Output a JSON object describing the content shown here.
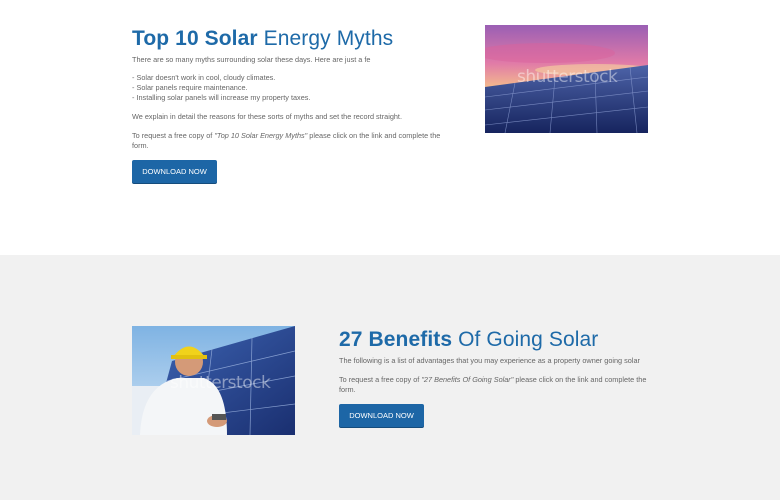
{
  "myths": {
    "title_bold": "Top 10 Solar",
    "title_rest": "Energy Myths",
    "intro": "There are so many myths surrounding solar these days. Here are just a fe",
    "list": [
      "- Solar doesn't work in cool, cloudy climates.",
      "- Solar panels require maintenance.",
      "- Installing solar panels will increase my property taxes."
    ],
    "explain": "We explain in detail the reasons for these sorts of myths and set the record straight.",
    "request_pre": "To request a free copy of ",
    "request_title": "\"Top 10 Solar Energy Myths\"",
    "request_post": " please click on the link and complete the",
    "request_line2": "form.",
    "button": "DOWNLOAD NOW",
    "image_watermark": "shutterstock"
  },
  "benefits": {
    "title_bold": "27 Benefits",
    "title_rest": "Of Going Solar",
    "intro": "The following is a list of advantages that you may experience as a property owner going solar",
    "request_pre": "To request a free copy of ",
    "request_title": "\"27 Benefits Of Going Solar\"",
    "request_post": " please click on the link and complete the",
    "request_line2": "form.",
    "button": "DOWNLOAD NOW",
    "image_watermark": "shutterstock"
  },
  "colors": {
    "accent": "#1e6aa8",
    "button": "#1d66a6",
    "section_bg": "#f1f1f1"
  }
}
